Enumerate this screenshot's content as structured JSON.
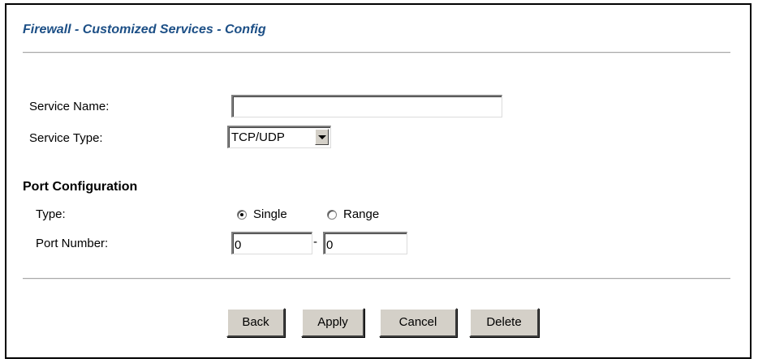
{
  "page": {
    "title": "Firewall - Customized Services - Config"
  },
  "form": {
    "service_name": {
      "label": "Service Name:",
      "value": ""
    },
    "service_type": {
      "label": "Service Type:",
      "value": "TCP/UDP"
    }
  },
  "port_config": {
    "heading": "Port Configuration",
    "type_label": "Type:",
    "options": [
      {
        "label": "Single",
        "checked": true
      },
      {
        "label": "Range",
        "checked": false
      }
    ],
    "port_number_label": "Port Number:",
    "port_start": "0",
    "separator": "-",
    "port_end": "0"
  },
  "buttons": {
    "back": "Back",
    "apply": "Apply",
    "cancel": "Cancel",
    "delete": "Delete"
  },
  "colors": {
    "title": "#1c4f86",
    "button_face": "#d4d0c8"
  },
  "icons": {
    "dropdown": "chevron-down-icon",
    "radio_selected": "radio-checked-icon",
    "radio_unselected": "radio-unchecked-icon"
  }
}
